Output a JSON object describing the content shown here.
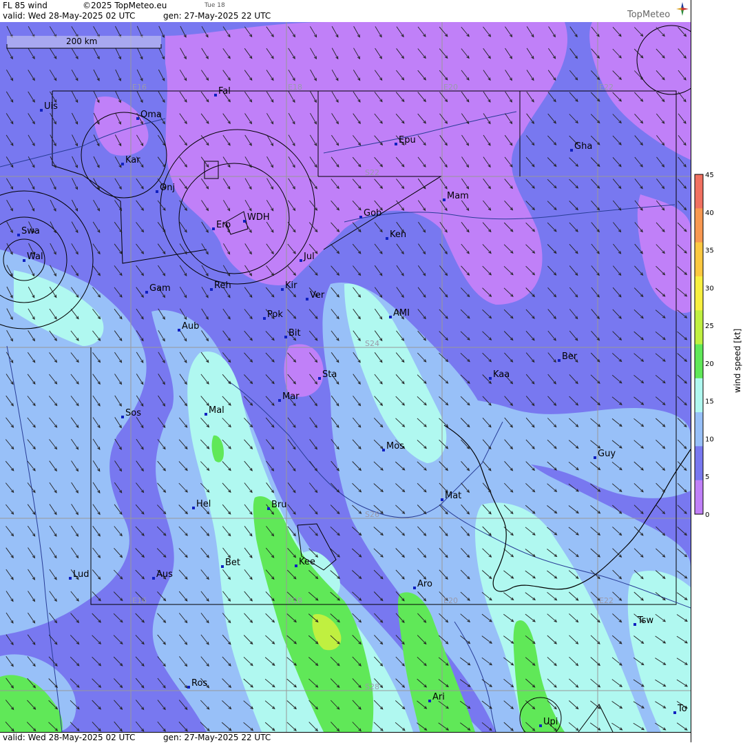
{
  "header": {
    "product": "FL 85 wind",
    "copyright": "©2025 TopMeteo.eu",
    "day": "Tue 18",
    "valid": "valid:  Wed  28-May-2025  02 UTC",
    "gen": "gen: 27-May-2025 22 UTC",
    "brand": "TopMeteo"
  },
  "footer": {
    "valid": "valid:  Wed  28-May-2025  02 UTC",
    "gen": "gen: 27-May-2025 22 UTC"
  },
  "scale": {
    "label": "200 km"
  },
  "legend": {
    "title": "wind speed [kt]",
    "ticks": [
      "45",
      "40",
      "35",
      "30",
      "25",
      "20",
      "15",
      "10",
      "5",
      "0"
    ],
    "colors": [
      "#f07060",
      "#f89850",
      "#fcc840",
      "#f8f040",
      "#c0f040",
      "#60e858",
      "#b0f8f0",
      "#98c0f8",
      "#7878f0",
      "#c080f8"
    ]
  },
  "grid_labels": {
    "lon_top": [
      "E16",
      "E18",
      "E20",
      "E22"
    ],
    "lon_bottom": [
      "E16",
      "E18",
      "E20",
      "E22"
    ],
    "lat": [
      "S22",
      "S24",
      "S26",
      "S28"
    ]
  },
  "cities": [
    {
      "name": "Uis"
    },
    {
      "name": "Oma"
    },
    {
      "name": "Fal"
    },
    {
      "name": "Epu"
    },
    {
      "name": "Gha"
    },
    {
      "name": "Kar"
    },
    {
      "name": "Onj"
    },
    {
      "name": "Mam"
    },
    {
      "name": "Gob"
    },
    {
      "name": "WDH"
    },
    {
      "name": "Swa"
    },
    {
      "name": "Ero"
    },
    {
      "name": "Ken"
    },
    {
      "name": "Wal"
    },
    {
      "name": "Jul"
    },
    {
      "name": "Gam"
    },
    {
      "name": "Reh"
    },
    {
      "name": "Kir"
    },
    {
      "name": "Ver"
    },
    {
      "name": "AMI"
    },
    {
      "name": "Pok"
    },
    {
      "name": "Aub"
    },
    {
      "name": "Bit"
    },
    {
      "name": "Ber"
    },
    {
      "name": "Kaa"
    },
    {
      "name": "Sta"
    },
    {
      "name": "Mar"
    },
    {
      "name": "Sos"
    },
    {
      "name": "Mal"
    },
    {
      "name": "Mos"
    },
    {
      "name": "Guy"
    },
    {
      "name": "Mat"
    },
    {
      "name": "Hel"
    },
    {
      "name": "Bru"
    },
    {
      "name": "Bet"
    },
    {
      "name": "Kee"
    },
    {
      "name": "Lud"
    },
    {
      "name": "Aus"
    },
    {
      "name": "Aro"
    },
    {
      "name": "Tsw"
    },
    {
      "name": "Ros"
    },
    {
      "name": "Ari"
    },
    {
      "name": "To"
    },
    {
      "name": "Upi"
    }
  ],
  "wind": {
    "direction": "north-westerly",
    "field_range_kt": [
      0,
      25
    ]
  }
}
